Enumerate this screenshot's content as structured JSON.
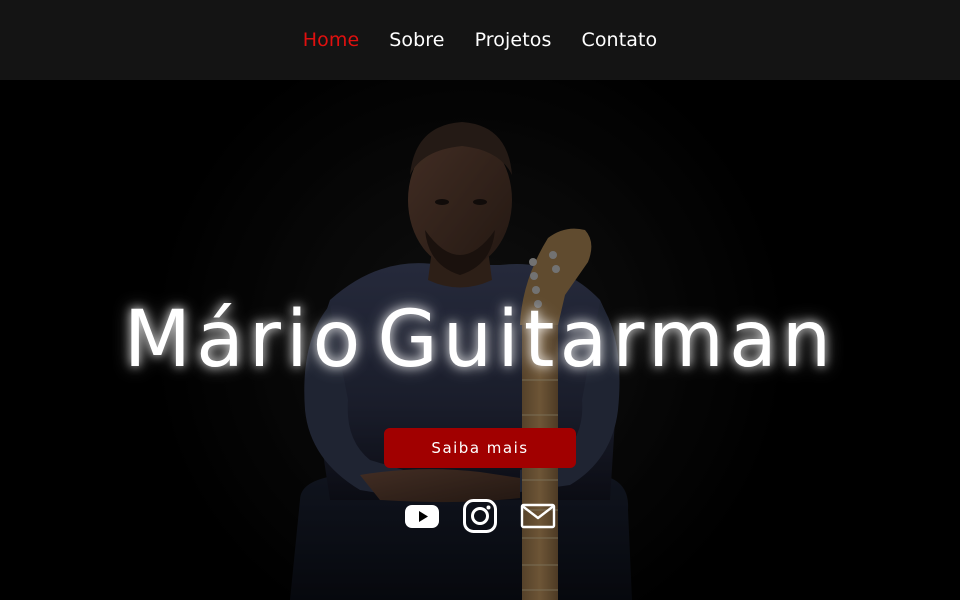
{
  "nav": {
    "items": [
      {
        "label": "Home",
        "active": true
      },
      {
        "label": "Sobre",
        "active": false
      },
      {
        "label": "Projetos",
        "active": false
      },
      {
        "label": "Contato",
        "active": false
      }
    ],
    "active_color": "#e0100f"
  },
  "hero": {
    "title_first": "Mário",
    "title_last": "Guitarman",
    "cta_label": "Saiba mais",
    "cta_color": "#a10000",
    "social_icons": [
      "youtube-icon",
      "instagram-icon",
      "mail-icon"
    ]
  }
}
